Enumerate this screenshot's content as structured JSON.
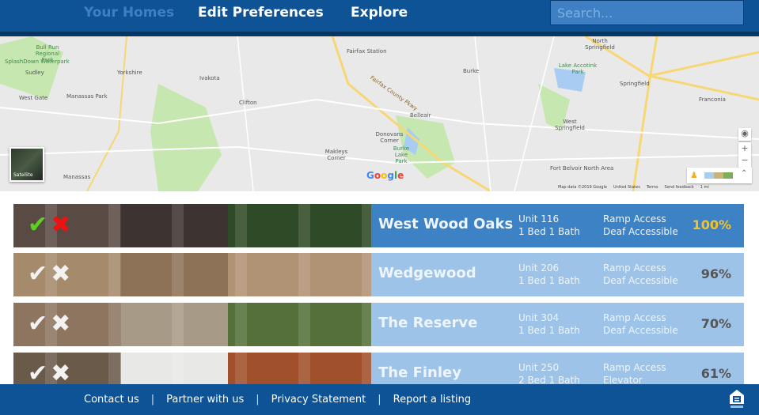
{
  "header": {
    "nav": [
      {
        "label": "Your Homes",
        "active": true
      },
      {
        "label": "Edit Preferences"
      },
      {
        "label": "Explore"
      }
    ],
    "search_placeholder": "Search..."
  },
  "map": {
    "labels": [
      "Bull Run Regional Park",
      "SplashDown Waterpark",
      "Sudley",
      "Yorkshire",
      "Ivakota",
      "West Gate",
      "Manassas Park",
      "Clifton",
      "Fairfax Station",
      "Burke",
      "Lake Accotink Park",
      "North Springfield",
      "Springfield",
      "Franconia",
      "Belleair",
      "West Springfield",
      "Donovans Corner",
      "Burke Lake Park",
      "Makleys Corner",
      "Manassas",
      "Fort Belvoir North Area",
      "Fairfax County Pkwy"
    ],
    "satellite_label": "Satellite",
    "logo": "Google",
    "attribution": [
      "Map data ©2019 Google",
      "United States",
      "Terms",
      "Send feedback",
      "1 mi"
    ],
    "colors": {
      "land": "#e9e9e9",
      "park": "#c6e8b0",
      "water": "#a9cdf2",
      "highway": "#f7d774",
      "road": "#ffffff"
    }
  },
  "listings": [
    {
      "name": "West Wood Oaks",
      "unit": "Unit 116",
      "beds": "1 Bed 1 Bath",
      "feature1": "Ramp Access",
      "feature2": "Deaf Accessible",
      "match": "100%",
      "active": true,
      "photo": [
        "#5a4a44",
        "#3d3330",
        "#2f4a26"
      ]
    },
    {
      "name": "Wedgewood",
      "unit": "Unit 206",
      "beds": "1 Bed 1 Bath",
      "feature1": "Ramp Access",
      "feature2": "Deaf Accessible",
      "match": "96%",
      "photo": [
        "#a58a6c",
        "#8e7257",
        "#b09274"
      ]
    },
    {
      "name": "The Reserve",
      "unit": "Unit 304",
      "beds": "1 Bed 1 Bath",
      "feature1": "Ramp Access",
      "feature2": "Deaf Accessible",
      "match": "70%",
      "photo": [
        "#8d7560",
        "#a79a86",
        "#56703a"
      ]
    },
    {
      "name": "The Finley",
      "unit": "Unit 250",
      "beds": "2 Bed 1 Bath",
      "feature1": "Ramp Access",
      "feature2": "Elevator",
      "match": "61%",
      "photo": [
        "#6a5a4a",
        "#e8e8e6",
        "#a0502a"
      ]
    }
  ],
  "icons": {
    "accept": "checkmark-icon",
    "reject": "x-icon"
  },
  "accent_colors": {
    "header": "#0d5396",
    "active_row": "#3e82c6",
    "row": "#9dc3e8",
    "match_highlight": "#f2c230",
    "accept_active": "#5ad21e",
    "reject_active": "#ee1111"
  },
  "footer": {
    "links": [
      "Contact us",
      "Partner with us",
      "Privacy Statement",
      "Report a listing"
    ]
  }
}
